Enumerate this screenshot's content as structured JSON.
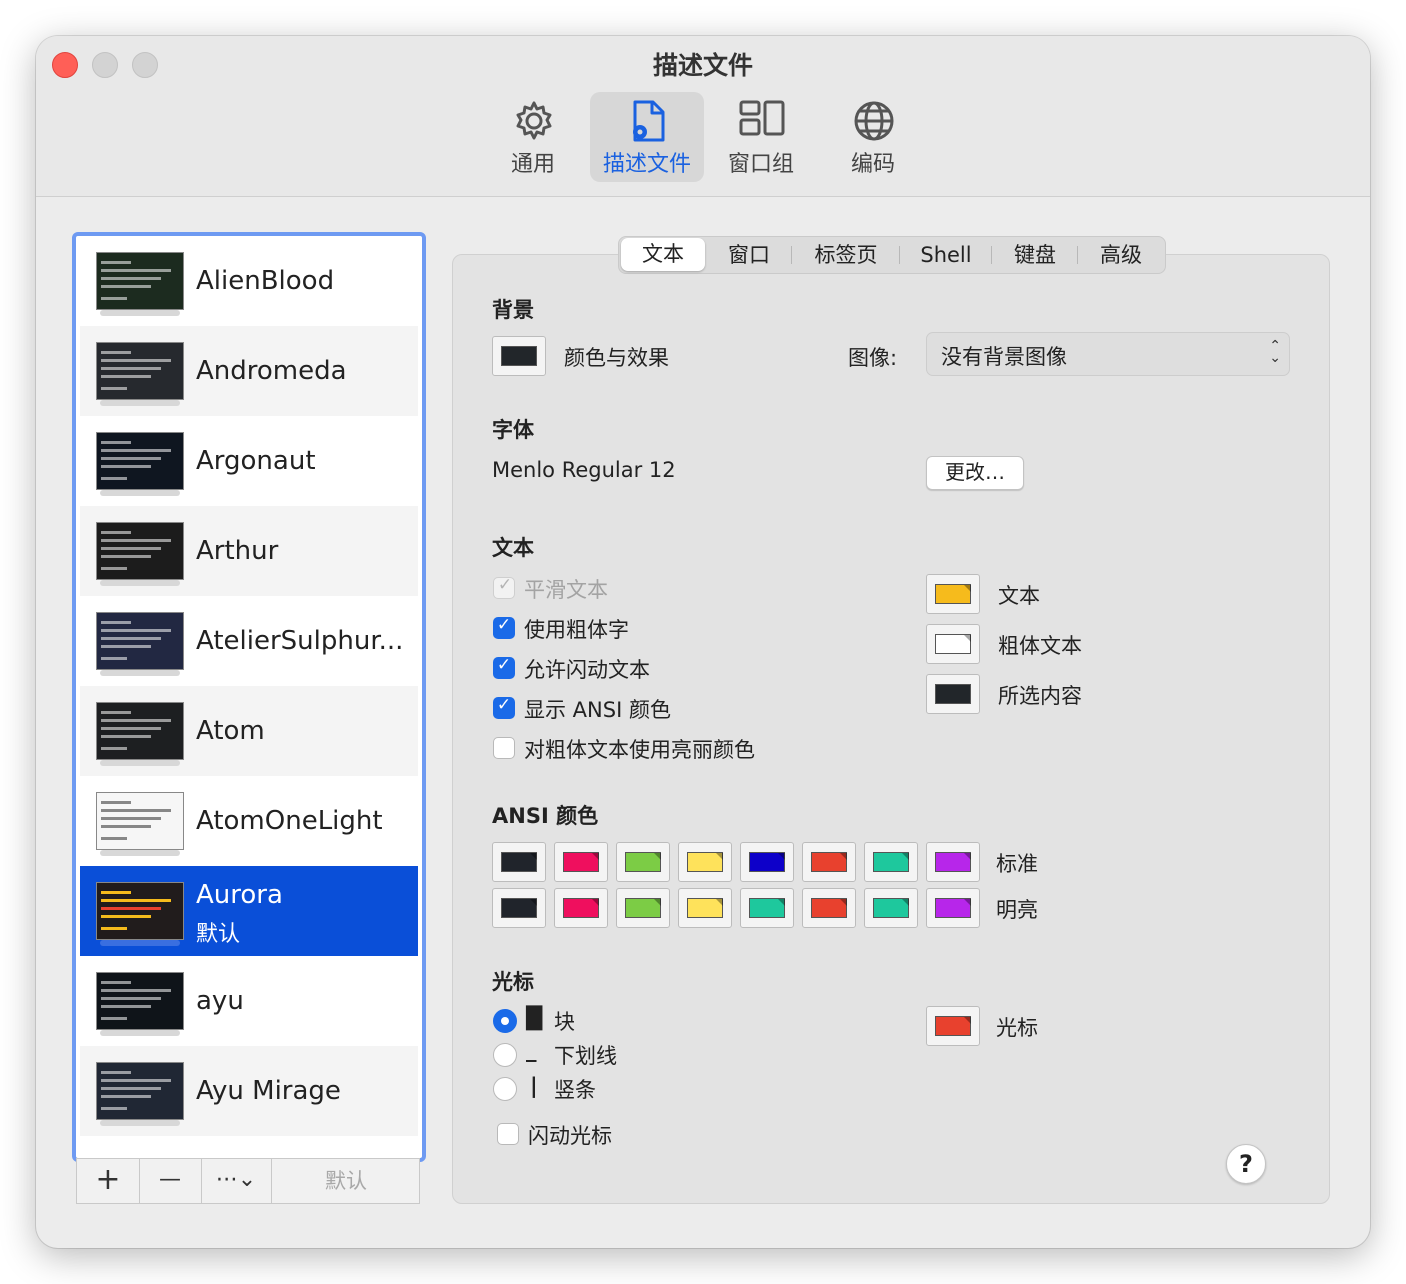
{
  "window": {
    "title": "描述文件"
  },
  "toolbar": [
    {
      "label": "通用",
      "icon": "gear-icon"
    },
    {
      "label": "描述文件",
      "icon": "profile-document-icon",
      "active": true
    },
    {
      "label": "窗口组",
      "icon": "window-groups-icon"
    },
    {
      "label": "编码",
      "icon": "globe-icon"
    }
  ],
  "profiles": [
    {
      "name": "AlienBlood",
      "thumb_bg": "#1c2b1f"
    },
    {
      "name": "Andromeda",
      "thumb_bg": "#26292e"
    },
    {
      "name": "Argonaut",
      "thumb_bg": "#0f1620"
    },
    {
      "name": "Arthur",
      "thumb_bg": "#1c1c1c"
    },
    {
      "name": "AtelierSulphur...",
      "thumb_bg": "#222842"
    },
    {
      "name": "Atom",
      "thumb_bg": "#1d1f21"
    },
    {
      "name": "AtomOneLight",
      "thumb_bg": "#f6f6f6"
    },
    {
      "name": "Aurora",
      "subtitle": "默认",
      "selected": true,
      "thumb_bg": "#211c1c"
    },
    {
      "name": "ayu",
      "thumb_bg": "#0f1419"
    },
    {
      "name": "Ayu Mirage",
      "thumb_bg": "#202734"
    }
  ],
  "list_bar": {
    "add": "+",
    "remove": "—",
    "more": "⋯⌄",
    "default": "默认"
  },
  "tabs": [
    "文本",
    "窗口",
    "标签页",
    "Shell",
    "键盘",
    "高级"
  ],
  "background": {
    "heading": "背景",
    "color_effect_label": "颜色与效果",
    "color": "#22262a",
    "image_label": "图像:",
    "image_value": "没有背景图像"
  },
  "font": {
    "heading": "字体",
    "value": "Menlo Regular 12",
    "change_button": "更改…"
  },
  "text": {
    "heading": "文本",
    "options": [
      {
        "label": "平滑文本",
        "checked": true,
        "disabled": true
      },
      {
        "label": "使用粗体字",
        "checked": true
      },
      {
        "label": "允许闪动文本",
        "checked": true
      },
      {
        "label": "显示 ANSI 颜色",
        "checked": true
      },
      {
        "label": "对粗体文本使用亮丽颜色",
        "checked": false
      }
    ],
    "colors": [
      {
        "label": "文本",
        "color": "#f6bb1c"
      },
      {
        "label": "粗体文本",
        "color": "#ffffff"
      },
      {
        "label": "所选内容",
        "color": "#22262a"
      }
    ]
  },
  "ansi": {
    "heading": "ANSI 颜色",
    "normal_label": "标准",
    "bright_label": "明亮",
    "normal": [
      "#20242b",
      "#ef0f5e",
      "#7ccc45",
      "#fee25b",
      "#0d00c9",
      "#e8412e",
      "#1ec89d",
      "#b726ea"
    ],
    "bright": [
      "#20242b",
      "#ef0f5e",
      "#7ccc45",
      "#fee25b",
      "#1ec89d",
      "#e8412e",
      "#1ec89d",
      "#b726ea"
    ]
  },
  "cursor": {
    "heading": "光标",
    "options": [
      {
        "glyph": "█",
        "label": "块",
        "selected": true
      },
      {
        "glyph": "_",
        "label": "下划线",
        "selected": false
      },
      {
        "glyph": "|",
        "label": "竖条",
        "selected": false
      }
    ],
    "blink_label": "闪动光标",
    "blink_checked": false,
    "color_label": "光标",
    "color": "#e8412e"
  },
  "help": "?"
}
